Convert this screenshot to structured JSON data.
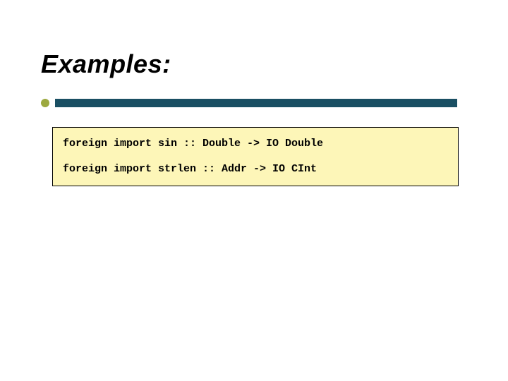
{
  "slide": {
    "title": "Examples:",
    "code": {
      "line1": "foreign import sin :: Double -> IO Double",
      "line2": "foreign import strlen :: Addr -> IO CInt"
    }
  },
  "colors": {
    "bullet": "#9ca93f",
    "bar": "#1a4f63",
    "codebox_bg": "#fdf6b8"
  }
}
